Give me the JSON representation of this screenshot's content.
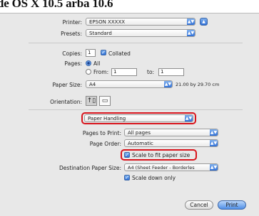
{
  "caption": "de OS X 10.5 arba 10.6",
  "printer": {
    "label": "Printer:",
    "value": "EPSON XXXXX"
  },
  "presets": {
    "label": "Presets:",
    "value": "Standard"
  },
  "copies": {
    "label": "Copies:",
    "value": "1",
    "collated_label": "Collated"
  },
  "pages": {
    "label": "Pages:",
    "all_label": "All",
    "from_label": "From:",
    "from_value": "1",
    "to_label": "to:",
    "to_value": "1"
  },
  "paper_size": {
    "label": "Paper Size:",
    "value": "A4",
    "dimensions": "21.00 by 29.70 cm"
  },
  "orientation": {
    "label": "Orientation:"
  },
  "section_popup": {
    "value": "Paper Handling"
  },
  "pages_to_print": {
    "label": "Pages to Print:",
    "value": "All pages"
  },
  "page_order": {
    "label": "Page Order:",
    "value": "Automatic"
  },
  "scale_to_fit": {
    "label": "Scale to fit paper size"
  },
  "destination_paper_size": {
    "label": "Destination Paper Size:",
    "value": "A4 (Sheet Feeder - Borderles"
  },
  "scale_down_only": {
    "label": "Scale down only"
  },
  "buttons": {
    "cancel": "Cancel",
    "print": "Print"
  },
  "colors": {
    "highlight": "#d8141c",
    "accent": "#2f6fd6"
  },
  "icons": {
    "arrow": "▲▼",
    "check": "✓",
    "portrait": "portrait-icon",
    "landscape": "landscape-icon"
  }
}
